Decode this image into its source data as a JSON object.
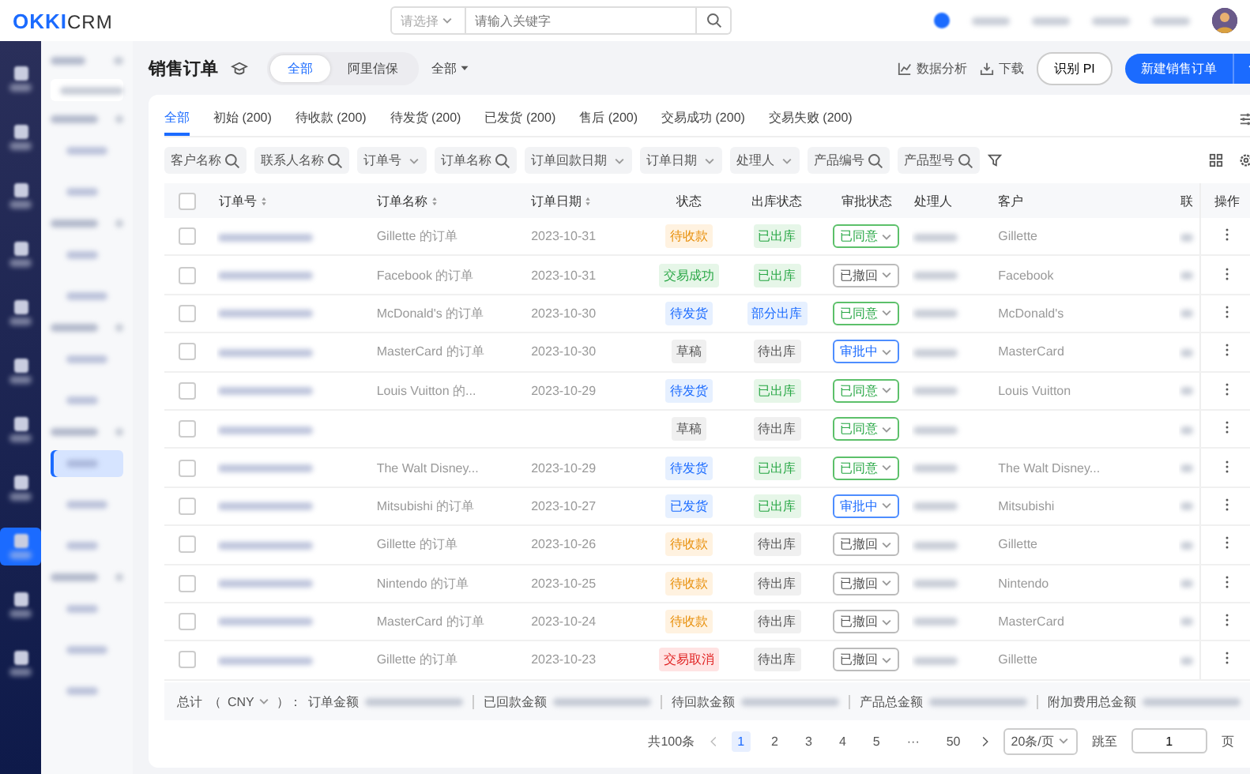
{
  "topbar": {
    "logo_left": "OKKI",
    "logo_right": "CRM",
    "search_type_placeholder": "请选择",
    "search_placeholder": "请输入关键字"
  },
  "nav_items": [
    {
      "selected": false
    },
    {
      "selected": false
    },
    {
      "selected": false
    },
    {
      "selected": false
    },
    {
      "selected": false
    },
    {
      "selected": false
    },
    {
      "selected": false
    },
    {
      "selected": false
    },
    {
      "selected": true
    },
    {
      "selected": false
    },
    {
      "selected": false
    }
  ],
  "menu": [
    {
      "kind": "group"
    },
    {
      "kind": "item",
      "selected": false
    },
    {
      "kind": "item",
      "selected": false
    },
    {
      "kind": "group"
    },
    {
      "kind": "item",
      "selected": false
    },
    {
      "kind": "item",
      "selected": false
    },
    {
      "kind": "group"
    },
    {
      "kind": "item",
      "selected": false
    },
    {
      "kind": "item",
      "selected": false
    },
    {
      "kind": "group"
    },
    {
      "kind": "item",
      "selected": true
    },
    {
      "kind": "item",
      "selected": false
    },
    {
      "kind": "item",
      "selected": false
    },
    {
      "kind": "group"
    },
    {
      "kind": "item",
      "selected": false
    },
    {
      "kind": "item",
      "selected": false
    },
    {
      "kind": "item",
      "selected": false
    }
  ],
  "header": {
    "title": "销售订单",
    "segments": [
      {
        "label": "全部",
        "selected": true
      },
      {
        "label": "阿里信保",
        "selected": false
      }
    ],
    "dropdown": "全部",
    "actions": [
      "数据分析",
      "下载"
    ],
    "recognize_button": "识别 PI",
    "new_button": "新建销售订单"
  },
  "tabs": [
    {
      "label": "全部",
      "selected": true
    },
    {
      "label": "初始 (200)",
      "selected": false
    },
    {
      "label": "待收款 (200)",
      "selected": false
    },
    {
      "label": "待发货 (200)",
      "selected": false
    },
    {
      "label": "已发货 (200)",
      "selected": false
    },
    {
      "label": "售后 (200)",
      "selected": false
    },
    {
      "label": "交易成功 (200)",
      "selected": false
    },
    {
      "label": "交易失败 (200)",
      "selected": false
    }
  ],
  "filters": [
    {
      "label": "客户名称",
      "kind": "search"
    },
    {
      "label": "联系人名称",
      "kind": "search"
    },
    {
      "label": "订单号",
      "kind": "select"
    },
    {
      "label": "订单名称",
      "kind": "search"
    },
    {
      "label": "订单回款日期",
      "kind": "select"
    },
    {
      "label": "订单日期",
      "kind": "select"
    },
    {
      "label": "处理人",
      "kind": "select"
    },
    {
      "label": "产品编号",
      "kind": "search"
    },
    {
      "label": "产品型号",
      "kind": "search"
    }
  ],
  "table": {
    "select_all_checked": false,
    "columns": [
      "订单号",
      "订单名称",
      "订单日期",
      "状态",
      "出库状态",
      "审批状态",
      "处理人",
      "客户",
      "联",
      "操作"
    ],
    "rows": [
      {
        "checked": false,
        "name": "Gillette 的订单",
        "date": "2023-10-31",
        "status": {
          "text": "待收款",
          "kind": "orange"
        },
        "stock": {
          "text": "已出库",
          "kind": "green"
        },
        "approval": {
          "text": "已同意",
          "kind": "green"
        },
        "customer": "Gillette"
      },
      {
        "checked": false,
        "name": "Facebook 的订单",
        "date": "2023-10-31",
        "status": {
          "text": "交易成功",
          "kind": "green"
        },
        "stock": {
          "text": "已出库",
          "kind": "green"
        },
        "approval": {
          "text": "已撤回",
          "kind": "grey"
        },
        "customer": "Facebook"
      },
      {
        "checked": false,
        "name": "McDonald's 的订单",
        "date": "2023-10-30",
        "status": {
          "text": "待发货",
          "kind": "blue"
        },
        "stock": {
          "text": "部分出库",
          "kind": "blue"
        },
        "approval": {
          "text": "已同意",
          "kind": "green"
        },
        "customer": "McDonald's"
      },
      {
        "checked": false,
        "name": "MasterCard 的订单",
        "date": "2023-10-30",
        "status": {
          "text": "草稿",
          "kind": "grey"
        },
        "stock": {
          "text": "待出库",
          "kind": "grey"
        },
        "approval": {
          "text": "审批中",
          "kind": "blue"
        },
        "customer": "MasterCard"
      },
      {
        "checked": false,
        "name": "Louis Vuitton 的...",
        "date": "2023-10-29",
        "status": {
          "text": "待发货",
          "kind": "blue"
        },
        "stock": {
          "text": "已出库",
          "kind": "green"
        },
        "approval": {
          "text": "已同意",
          "kind": "green"
        },
        "customer": "Louis Vuitton"
      },
      {
        "checked": false,
        "status": {
          "text": "草稿",
          "kind": "grey"
        },
        "stock": {
          "text": "待出库",
          "kind": "grey"
        },
        "approval": {
          "text": "已同意",
          "kind": "green"
        }
      },
      {
        "checked": false,
        "name": "The Walt Disney...",
        "date": "2023-10-29",
        "status": {
          "text": "待发货",
          "kind": "blue"
        },
        "stock": {
          "text": "已出库",
          "kind": "green"
        },
        "approval": {
          "text": "已同意",
          "kind": "green"
        },
        "customer": "The Walt Disney..."
      },
      {
        "checked": false,
        "name": "Mitsubishi 的订单",
        "date": "2023-10-27",
        "status": {
          "text": "已发货",
          "kind": "blue"
        },
        "stock": {
          "text": "已出库",
          "kind": "green"
        },
        "approval": {
          "text": "审批中",
          "kind": "blue"
        },
        "customer": "Mitsubishi"
      },
      {
        "checked": false,
        "name": "Gillette 的订单",
        "date": "2023-10-26",
        "status": {
          "text": "待收款",
          "kind": "orange"
        },
        "stock": {
          "text": "待出库",
          "kind": "grey"
        },
        "approval": {
          "text": "已撤回",
          "kind": "grey"
        },
        "customer": "Gillette"
      },
      {
        "checked": false,
        "name": "Nintendo 的订单",
        "date": "2023-10-25",
        "status": {
          "text": "待收款",
          "kind": "orange"
        },
        "stock": {
          "text": "待出库",
          "kind": "grey"
        },
        "approval": {
          "text": "已撤回",
          "kind": "grey"
        },
        "customer": "Nintendo"
      },
      {
        "checked": false,
        "name": "MasterCard 的订单",
        "date": "2023-10-24",
        "status": {
          "text": "待收款",
          "kind": "orange"
        },
        "stock": {
          "text": "待出库",
          "kind": "grey"
        },
        "approval": {
          "text": "已撤回",
          "kind": "grey"
        },
        "customer": "MasterCard"
      },
      {
        "checked": false,
        "name": "Gillette 的订单",
        "date": "2023-10-23",
        "status": {
          "text": "交易取消",
          "kind": "red"
        },
        "stock": {
          "text": "待出库",
          "kind": "grey"
        },
        "approval": {
          "text": "已撤回",
          "kind": "grey"
        },
        "customer": "Gillette"
      }
    ]
  },
  "summary": {
    "label": "总计",
    "paren_open": "（",
    "currency": "CNY",
    "paren_close": "）：",
    "items": [
      "订单金额",
      "已回款金额",
      "待回款金额",
      "产品总金额",
      "附加费用总金额"
    ]
  },
  "pagination": {
    "total": "共100条",
    "pages": [
      {
        "label": "1",
        "selected": true
      },
      {
        "label": "2",
        "selected": false
      },
      {
        "label": "3",
        "selected": false
      },
      {
        "label": "4",
        "selected": false
      },
      {
        "label": "5",
        "selected": false
      },
      {
        "label": "···",
        "selected": false
      },
      {
        "label": "50",
        "selected": false
      }
    ],
    "page_size": "20条/页",
    "jump_label": "跳至",
    "jump_value": "1",
    "page_unit": "页"
  }
}
